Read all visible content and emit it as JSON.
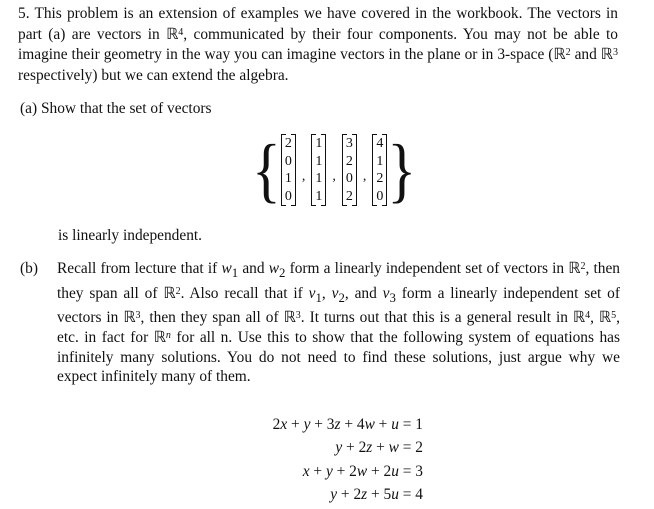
{
  "problem": {
    "number": "5.",
    "intro_html": "This problem is an extension of examples we have covered in the workbook. The vectors in part (a) are vectors in ℝ<sup>4</sup>, communicated by their four components. You may not be able to imagine their geometry in the way you can imagine vectors in the plane or in 3-space (ℝ<sup>2</sup> and ℝ<sup>3</sup> respectively) but we can extend the algebra."
  },
  "part_a": {
    "label": "(a)",
    "prompt": "Show that the set of vectors",
    "vectors": [
      [
        "2",
        "0",
        "1",
        "0"
      ],
      [
        "1",
        "1",
        "1",
        "1"
      ],
      [
        "3",
        "2",
        "0",
        "2"
      ],
      [
        "4",
        "1",
        "2",
        "0"
      ]
    ],
    "conclusion": "is linearly independent."
  },
  "part_b": {
    "label": "(b)",
    "body_html": "Recall from lecture that if <i>w</i><sub>1</sub> and <i>w</i><sub>2</sub> form a linearly independent set of vectors in ℝ<sup>2</sup>, then they span all of ℝ<sup>2</sup>. Also recall that if <i>v</i><sub>1</sub>, <i>v</i><sub>2</sub>, and <i>v</i><sub>3</sub> form a linearly independent set of vectors in ℝ<sup>3</sup>, then they span all of ℝ<sup>3</sup>. It turns out that this is a general result in ℝ<sup>4</sup>, ℝ<sup>5</sup>, etc. in fact for ℝ<sup><i>n</i></sup> for all n. Use this to show that the following system of equations has infinitely many solutions. You do not need to find these solutions, just argue why we expect infinitely many of them.",
    "equations_html": [
      "2<i>x</i> + <i>y</i> + 3<i>z</i> + 4<i>w</i> + <i>u</i> = 1",
      "<i>y</i> + 2<i>z</i> + <i>w</i> = 2",
      "<i>x</i> + <i>y</i> + 2<i>w</i> + 2<i>u</i> = 3",
      "<i>y</i> + 2<i>z</i> + 5<i>u</i> = 4"
    ]
  }
}
